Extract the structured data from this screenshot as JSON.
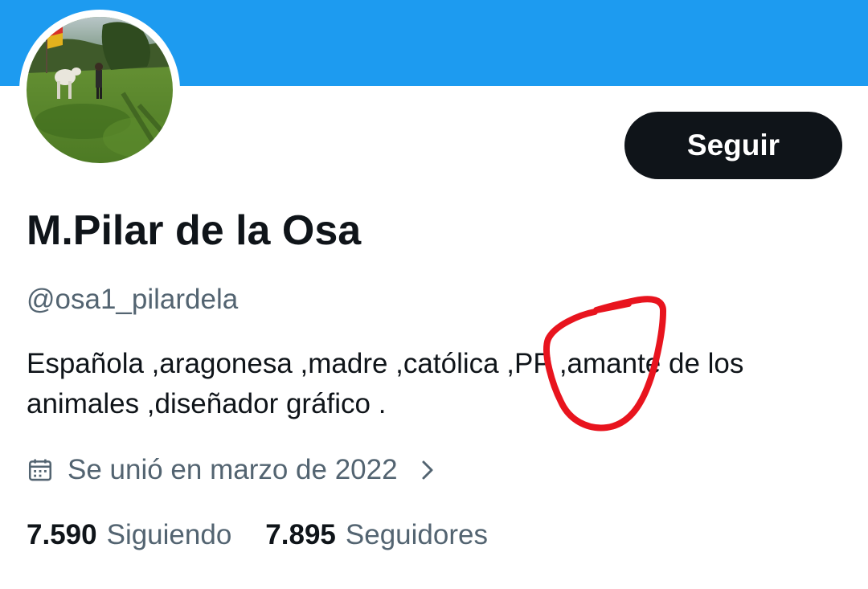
{
  "profile": {
    "follow_label": "Seguir",
    "display_name": "M.Pilar de la Osa",
    "handle": "@osa1_pilardela",
    "bio": "Española ,aragonesa ,madre ,católica ,PP ,amante de los animales ,diseñador gráfico .",
    "joined": "Se unió en marzo de 2022",
    "following_count": "7.590",
    "following_label": "Siguiendo",
    "followers_count": "7.895",
    "followers_label": "Seguidores"
  },
  "icons": {
    "joined": "calendar-icon",
    "joined_more": "chevron-right-icon"
  },
  "colors": {
    "banner": "#1d9bf0",
    "follow_button": "#0f1419",
    "primary_text": "#0f1419",
    "secondary_text": "#536471",
    "annotation": "#e8141e"
  }
}
